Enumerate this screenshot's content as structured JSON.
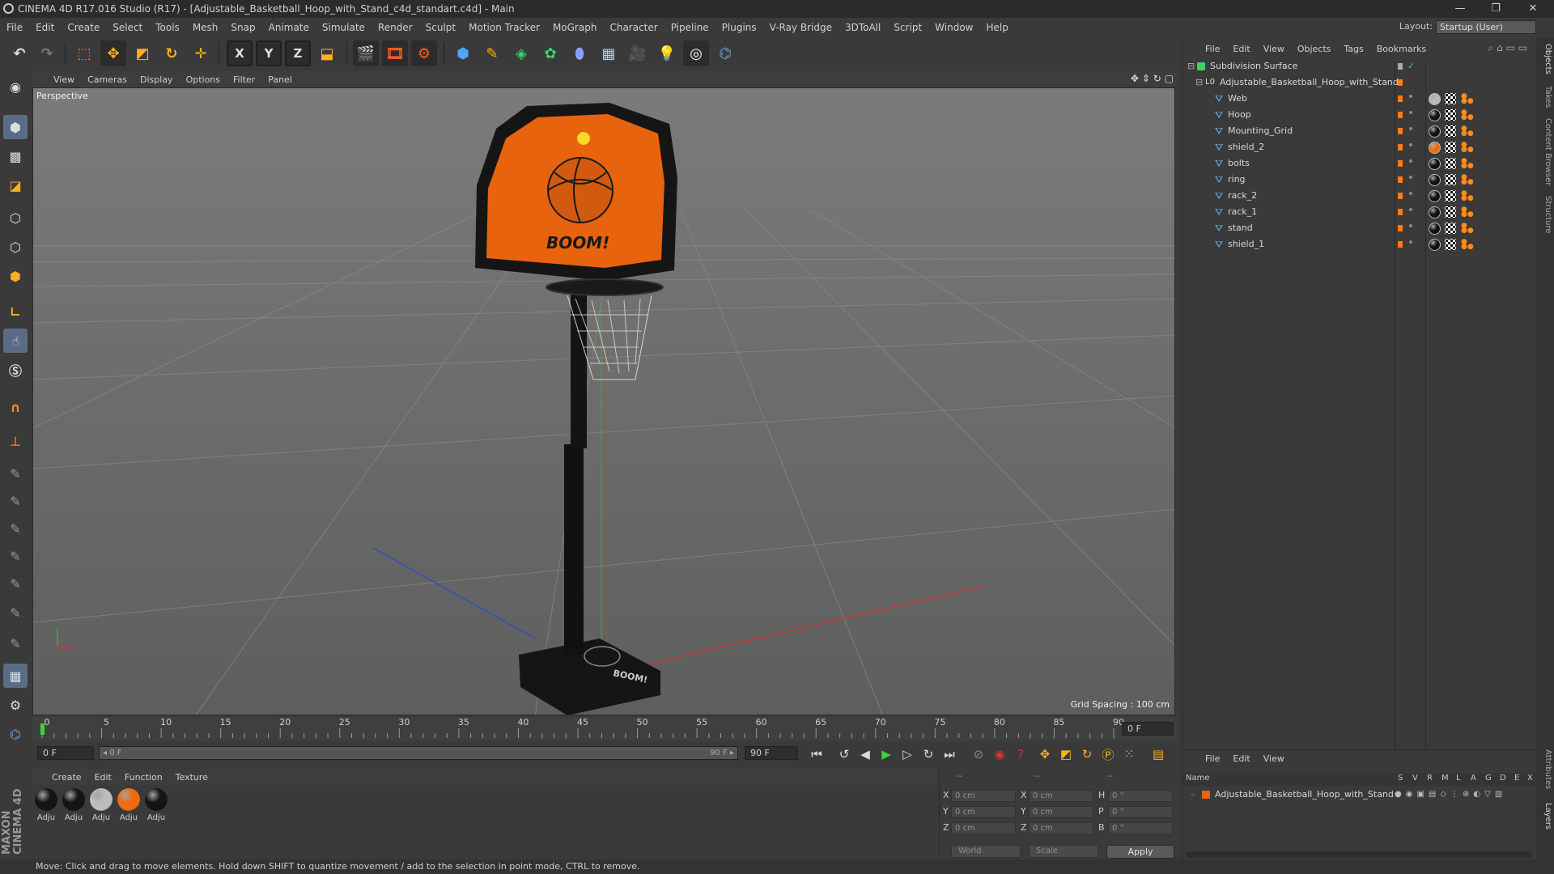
{
  "window": {
    "title": "CINEMA 4D R17.016 Studio (R17) - [Adjustable_Basketball_Hoop_with_Stand_c4d_standart.c4d] - Main",
    "minimize": "—",
    "maximize": "❐",
    "close": "✕"
  },
  "menu": [
    "File",
    "Edit",
    "Create",
    "Select",
    "Tools",
    "Mesh",
    "Snap",
    "Animate",
    "Simulate",
    "Render",
    "Sculpt",
    "Motion Tracker",
    "MoGraph",
    "Character",
    "Pipeline",
    "Plugins",
    "V-Ray Bridge",
    "3DToAll",
    "Script",
    "Window",
    "Help"
  ],
  "layout": {
    "label": "Layout:",
    "value": "Startup (User)"
  },
  "toolbar": {
    "x": "X",
    "y": "Y",
    "z": "Z"
  },
  "viewport": {
    "menu": [
      "View",
      "Cameras",
      "Display",
      "Options",
      "Filter",
      "Panel"
    ],
    "label": "Perspective",
    "grid_spacing": "Grid Spacing : 100 cm",
    "backboard_text": "BOOM!",
    "base_text": "BOOM!"
  },
  "timeline": {
    "ticks": [
      "0",
      "5",
      "10",
      "15",
      "20",
      "25",
      "30",
      "35",
      "40",
      "45",
      "50",
      "55",
      "60",
      "65",
      "70",
      "75",
      "80",
      "85",
      "90"
    ],
    "current_frame": "0 F"
  },
  "transport": {
    "start_field": "0 F",
    "range_start": "◂ 0 F",
    "range_end": "90 F ▸",
    "end_field": "90 F"
  },
  "materials": {
    "menu": [
      "Create",
      "Edit",
      "Function",
      "Texture"
    ],
    "items": [
      {
        "name": "Adju",
        "color": "#151515"
      },
      {
        "name": "Adju",
        "color": "#151515"
      },
      {
        "name": "Adju",
        "color": "#bdbdbd"
      },
      {
        "name": "Adju",
        "color": "#f06a10"
      },
      {
        "name": "Adju",
        "color": "#151515"
      }
    ]
  },
  "coords": {
    "header": [
      "--",
      "--",
      "--"
    ],
    "rows": [
      {
        "l1": "X",
        "v1": "0 cm",
        "l2": "X",
        "v2": "0 cm",
        "l3": "H",
        "v3": "0 °"
      },
      {
        "l1": "Y",
        "v1": "0 cm",
        "l2": "Y",
        "v2": "0 cm",
        "l3": "P",
        "v3": "0 °"
      },
      {
        "l1": "Z",
        "v1": "0 cm",
        "l2": "Z",
        "v2": "0 cm",
        "l3": "B",
        "v3": "0 °"
      }
    ],
    "mode": "World",
    "scale": "Scale",
    "apply": "Apply"
  },
  "objects": {
    "menu": [
      "File",
      "Edit",
      "View",
      "Objects",
      "Tags",
      "Bookmarks"
    ],
    "root": "Subdivision Surface",
    "group": "Adjustable_Basketball_Hoop_with_Stand",
    "items": [
      {
        "name": "Web",
        "tag": "#b8b8b8"
      },
      {
        "name": "Hoop",
        "tag": "#111111"
      },
      {
        "name": "Mounting_Grid",
        "tag": "#111111"
      },
      {
        "name": "shield_2",
        "tag": "#f06a10"
      },
      {
        "name": "bolts",
        "tag": "#111111"
      },
      {
        "name": "ring",
        "tag": "#111111"
      },
      {
        "name": "rack_2",
        "tag": "#111111"
      },
      {
        "name": "rack_1",
        "tag": "#111111"
      },
      {
        "name": "stand",
        "tag": "#111111"
      },
      {
        "name": "shield_1",
        "tag": "#111111"
      }
    ]
  },
  "layers": {
    "menu": [
      "File",
      "Edit",
      "View"
    ],
    "header": {
      "name": "Name",
      "cols": [
        "S",
        "V",
        "R",
        "M",
        "L",
        "A",
        "G",
        "D",
        "E",
        "X"
      ]
    },
    "row": "Adjustable_Basketball_Hoop_with_Stand"
  },
  "sidetabs": {
    "objects": "Objects",
    "takes": "Takes",
    "content": "Content Browser",
    "structure": "Structure",
    "attributes": "Attributes",
    "layers": "Layers"
  },
  "status": "Move: Click and drag to move elements. Hold down SHIFT to quantize movement / add to the selection in point mode, CTRL to remove.",
  "brand": "MAXON CINEMA 4D",
  "colors": {
    "accent_orange": "#f06a10",
    "active_blue": "#5a6c85",
    "axis_x": "#d03030",
    "axis_y": "#30b030",
    "axis_z": "#3050c0"
  }
}
